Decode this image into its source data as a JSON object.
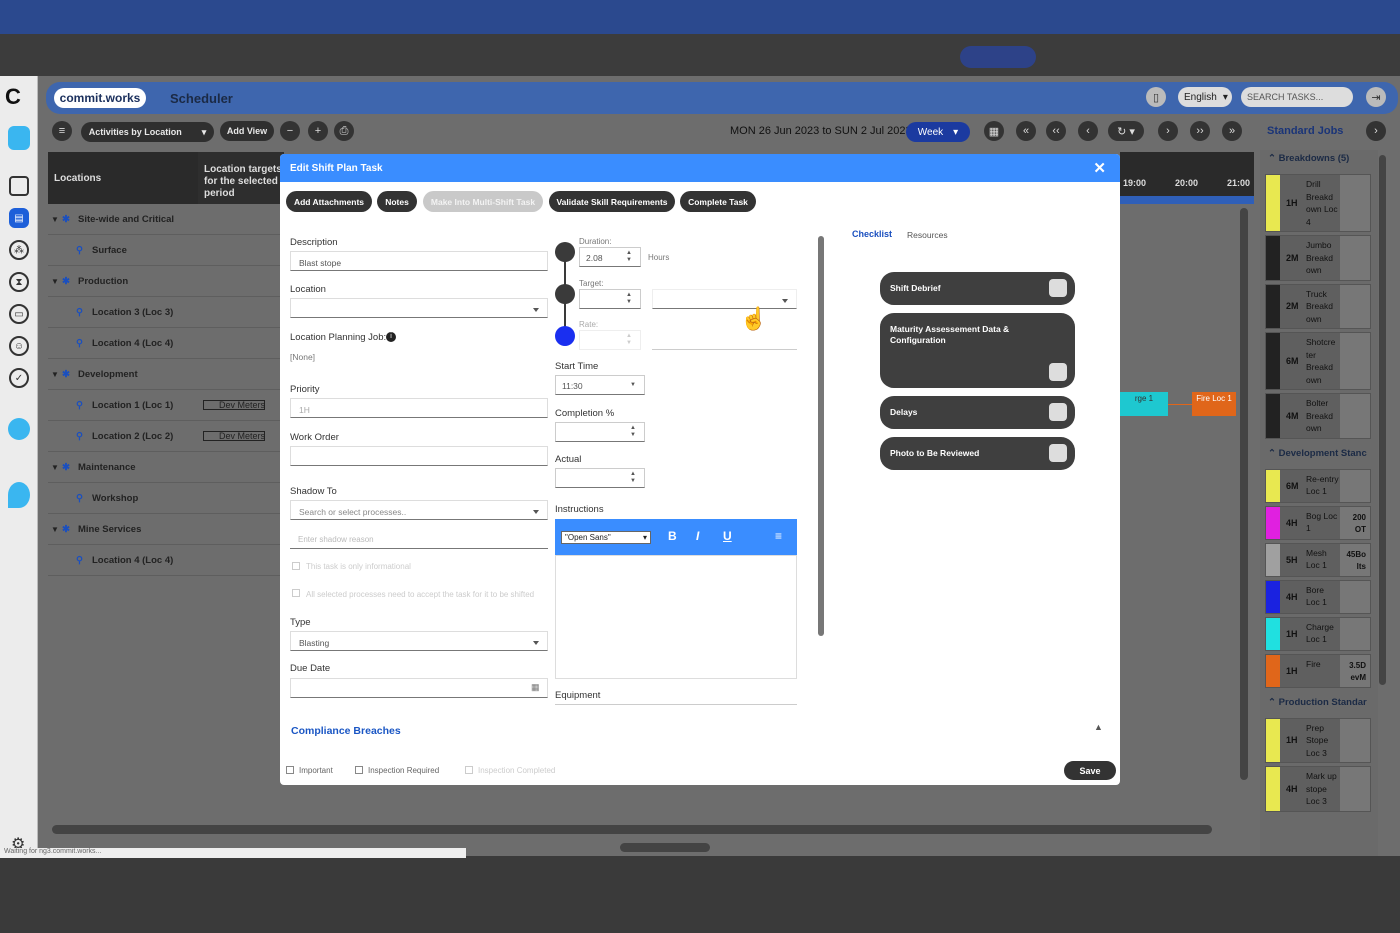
{
  "app": {
    "logo": "commit.works",
    "title": "Scheduler",
    "language": "English",
    "search_placeholder": "SEARCH TASKS...",
    "status_text": "Waiting for ng3.commit.works..."
  },
  "toolbar": {
    "view_select": "Activities by Location",
    "add_view": "Add View",
    "date_range": "MON 26 Jun 2023 to SUN 2 Jul 2023",
    "period": "Week",
    "standard_jobs": "Standard Jobs"
  },
  "grid": {
    "locations_header": "Locations",
    "targets_header": "Location targets for the selected period",
    "rows": [
      {
        "label": "Site-wide and Critical",
        "level": 0,
        "icon": "asterisk-icon"
      },
      {
        "label": "Surface",
        "level": 1,
        "icon": "pin-icon"
      },
      {
        "label": "Production",
        "level": 0,
        "icon": "asterisk-icon"
      },
      {
        "label": "Location 3 (Loc 3)",
        "level": 1,
        "icon": "pin-icon"
      },
      {
        "label": "Location 4 (Loc 4)",
        "level": 1,
        "icon": "pin-icon"
      },
      {
        "label": "Development",
        "level": 0,
        "icon": "asterisk-icon"
      },
      {
        "label": "Location 1 (Loc 1)",
        "level": 1,
        "icon": "pin-icon",
        "target": "Dev Meters"
      },
      {
        "label": "Location 2 (Loc 2)",
        "level": 1,
        "icon": "pin-icon",
        "target": "Dev Meters"
      },
      {
        "label": "Maintenance",
        "level": 0,
        "icon": "asterisk-icon"
      },
      {
        "label": "Workshop",
        "level": 1,
        "icon": "pin-icon"
      },
      {
        "label": "Mine Services",
        "level": 0,
        "icon": "asterisk-icon"
      },
      {
        "label": "Location 4 (Loc 4)",
        "level": 1,
        "icon": "pin-icon"
      }
    ],
    "hours": [
      "19:00",
      "20:00",
      "21:00"
    ],
    "blocks": [
      {
        "label": "rge 1",
        "color": "#1ec8d0"
      },
      {
        "label": "Fire Loc 1",
        "color": "#e0661a"
      }
    ]
  },
  "standard_jobs": {
    "sections": [
      {
        "title": "Breakdowns (5)",
        "jobs": [
          {
            "dur": "1H",
            "name": "Drill Breakd own Loc 4",
            "color": "#e8e850"
          },
          {
            "dur": "2M",
            "name": "Jumbo Breakd own",
            "color": "#222"
          },
          {
            "dur": "2M",
            "name": "Truck Breakd own",
            "color": "#222"
          },
          {
            "dur": "6M",
            "name": "Shotcre ter Breakd own",
            "color": "#222"
          },
          {
            "dur": "4M",
            "name": "Bolter Breakd own",
            "color": "#222"
          }
        ]
      },
      {
        "title": "Development Stanc",
        "jobs": [
          {
            "dur": "6M",
            "name": "Re-entry Loc 1",
            "color": "#e8e850"
          },
          {
            "dur": "4H",
            "name": "Bog Loc 1",
            "color": "#e020e0",
            "extra": "200 OT"
          },
          {
            "dur": "5H",
            "name": "Mesh Loc 1",
            "color": "#a0a0a0",
            "extra": "45Bo lts"
          },
          {
            "dur": "4H",
            "name": "Bore Loc 1",
            "color": "#1a22e0"
          },
          {
            "dur": "1H",
            "name": "Charge Loc 1",
            "color": "#20e0e0"
          },
          {
            "dur": "1H",
            "name": "Fire",
            "color": "#e0661a",
            "extra": "3.5D evM"
          }
        ]
      },
      {
        "title": "Production Standar",
        "jobs": [
          {
            "dur": "1H",
            "name": "Prep Stope Loc 3",
            "color": "#e8e850"
          },
          {
            "dur": "4H",
            "name": "Mark up stope Loc 3",
            "color": "#e8e850"
          }
        ]
      }
    ]
  },
  "modal": {
    "title": "Edit Shift Plan Task",
    "buttons": {
      "attachments": "Add Attachments",
      "notes": "Notes",
      "multishift": "Make Into Multi-Shift Task",
      "validate": "Validate Skill Requirements",
      "complete": "Complete Task"
    },
    "fields": {
      "description_label": "Description",
      "description_value": "Blast stope",
      "location_label": "Location",
      "location_value": "",
      "planning_job_label": "Location Planning Job:",
      "planning_job_value": "[None]",
      "priority_label": "Priority",
      "priority_value": "1H",
      "work_order_label": "Work Order",
      "shadow_label": "Shadow To",
      "shadow_placeholder": "Search or select processes..",
      "shadow_reason_placeholder": "Enter shadow reason",
      "informational_label": "This task is only informational",
      "accept_label": "All selected processes need to accept the task for it to be shifted",
      "type_label": "Type",
      "type_value": "Blasting",
      "due_date_label": "Due Date",
      "duration_label": "Duration:",
      "duration_value": "2.08",
      "duration_unit": "Hours",
      "target_label": "Target:",
      "rate_label": "Rate:",
      "start_time_label": "Start Time",
      "start_time_value": "11:30",
      "completion_label": "Completion %",
      "actual_label": "Actual",
      "instructions_label": "Instructions",
      "font_value": "\"Open Sans\"",
      "equipment_label": "Equipment"
    },
    "tabs": {
      "checklist": "Checklist",
      "resources": "Resources"
    },
    "checklist": [
      "Shift Debrief",
      "Maturity Assessement Data & Configuration",
      "Delays",
      "Photo to Be Reviewed"
    ],
    "compliance": "Compliance Breaches",
    "footer": {
      "important": "Important",
      "inspection_required": "Inspection Required",
      "inspection_completed": "Inspection Completed",
      "save": "Save"
    }
  }
}
